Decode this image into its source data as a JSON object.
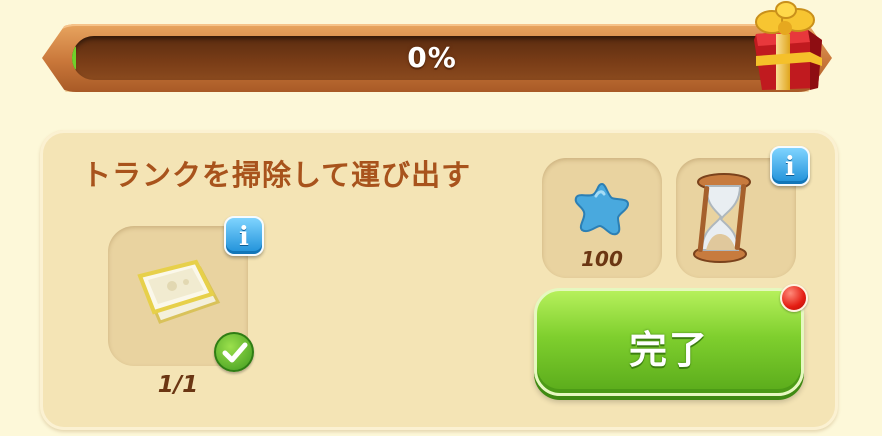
{
  "progress": {
    "percent_label": "0%",
    "value": 0
  },
  "task": {
    "title": "トランクを掃除して運び出す"
  },
  "requirement": {
    "item_icon": "cloth-bundle-icon",
    "count": "1/1",
    "completed": true
  },
  "rewards": {
    "star": {
      "icon": "blue-star-icon",
      "amount": "100"
    },
    "time": {
      "icon": "hourglass-icon"
    }
  },
  "info_icon": "info-icon",
  "done_button": {
    "label": "完了",
    "has_notification": true
  },
  "colors": {
    "background": "#fdf8d9",
    "panel": "#f4e4b5",
    "title": "#a8531c",
    "button_green": "#7fcf2e",
    "info_blue": "#1d8fd8",
    "notification_red": "#e41d12"
  }
}
